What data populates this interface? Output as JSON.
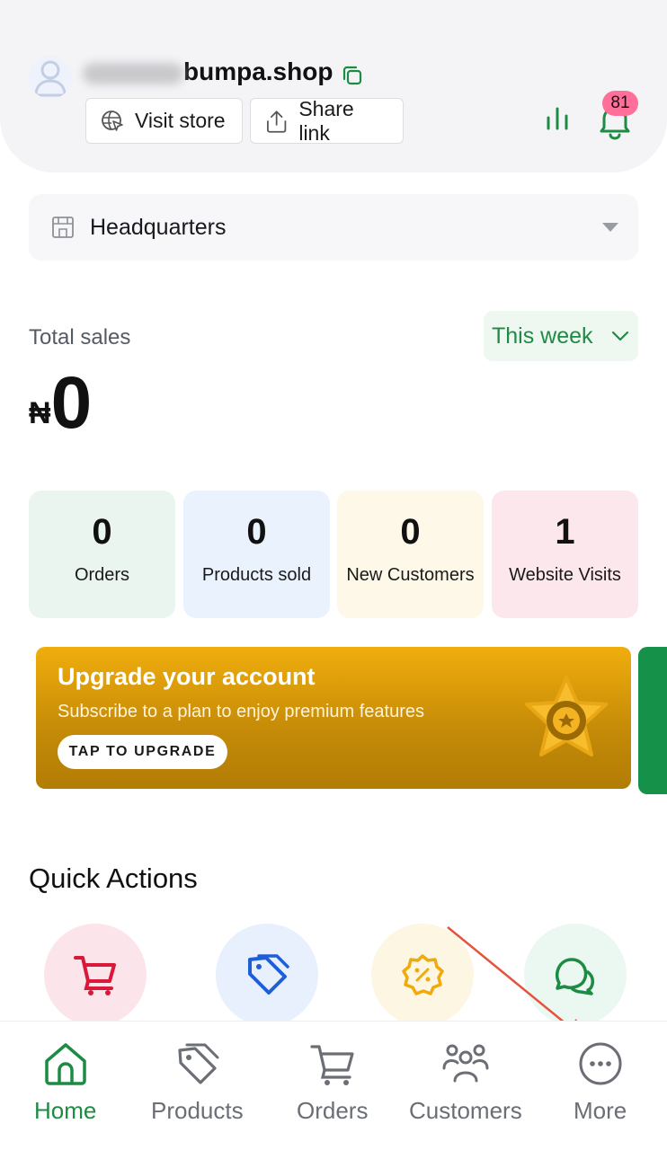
{
  "header": {
    "store_domain": "bumpa.shop",
    "visit_store_label": "Visit store",
    "share_link_label": "Share link",
    "notification_count": "81"
  },
  "location": {
    "label": "Headquarters"
  },
  "sales": {
    "label": "Total sales",
    "period_label": "This week",
    "currency_symbol": "₦",
    "amount": "0"
  },
  "stats": [
    {
      "value": "0",
      "label": "Orders",
      "bg": "#ebf5ef"
    },
    {
      "value": "0",
      "label": "Products sold",
      "bg": "#eaf2fd"
    },
    {
      "value": "0",
      "label": "New Customers",
      "bg": "#fdf8e8"
    },
    {
      "value": "1",
      "label": "Website Visits",
      "bg": "#fce7ec"
    }
  ],
  "banner": {
    "title": "Upgrade your account",
    "subtitle": "Subscribe to a plan to enjoy premium features",
    "button_label": "TAP TO UPGRADE"
  },
  "quick_actions": {
    "title": "Quick Actions",
    "items": [
      {
        "icon": "cart-icon",
        "bg": "#fce5ea",
        "color": "#d9183a"
      },
      {
        "icon": "tag-icon",
        "bg": "#e8f0fd",
        "color": "#1f5fd6"
      },
      {
        "icon": "discount-badge-icon",
        "bg": "#fdf6e2",
        "color": "#f0aa0b"
      },
      {
        "icon": "chat-icon",
        "bg": "#ebf8f2",
        "color": "#1e8b45"
      }
    ]
  },
  "nav": {
    "items": [
      {
        "label": "Home",
        "icon": "home-icon",
        "active": true
      },
      {
        "label": "Products",
        "icon": "tag-icon",
        "active": false
      },
      {
        "label": "Orders",
        "icon": "cart-icon",
        "active": false
      },
      {
        "label": "Customers",
        "icon": "users-icon",
        "active": false
      },
      {
        "label": "More",
        "icon": "more-icon",
        "active": false
      }
    ]
  },
  "colors": {
    "brand_green": "#1e8b45",
    "badge_pink": "#ff6f9a",
    "annotation_arrow": "#e5533c"
  }
}
